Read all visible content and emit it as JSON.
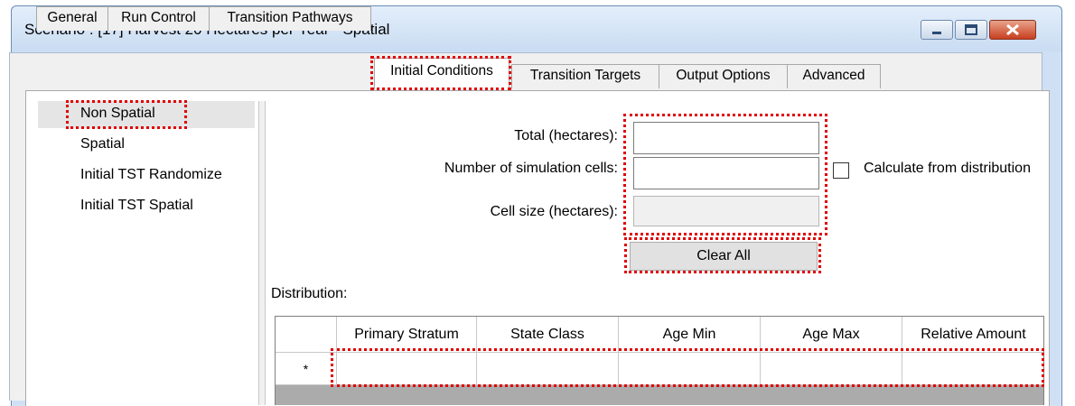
{
  "window": {
    "title": "Scenario : [17] Harvest 20 Hectares per Year - Spatial",
    "minimize_icon": "minimize-icon",
    "maximize_icon": "maximize-icon",
    "close_icon": "close-icon"
  },
  "tabs": [
    {
      "label": "General"
    },
    {
      "label": "Run Control"
    },
    {
      "label": "Transition Pathways"
    },
    {
      "label": "Initial Conditions",
      "active": true
    },
    {
      "label": "Transition Targets"
    },
    {
      "label": "Output Options"
    },
    {
      "label": "Advanced"
    }
  ],
  "nav": {
    "items": [
      {
        "label": "Non Spatial",
        "selected": true
      },
      {
        "label": "Spatial"
      },
      {
        "label": "Initial TST Randomize"
      },
      {
        "label": "Initial TST Spatial"
      }
    ]
  },
  "form": {
    "total_label": "Total (hectares):",
    "total_value": "",
    "cells_label": "Number of simulation cells:",
    "cells_value": "",
    "cell_size_label": "Cell size (hectares):",
    "cell_size_value": "",
    "calc_checkbox_label": "Calculate from distribution",
    "calc_checked": false,
    "clear_button": "Clear All"
  },
  "distribution": {
    "label": "Distribution:",
    "columns": [
      "Primary Stratum",
      "State Class",
      "Age Min",
      "Age Max",
      "Relative Amount"
    ],
    "new_row_marker": "*"
  },
  "colors": {
    "highlight": "#e00000",
    "title_bar": "#cfe0f4",
    "close_button": "#c7401f"
  }
}
